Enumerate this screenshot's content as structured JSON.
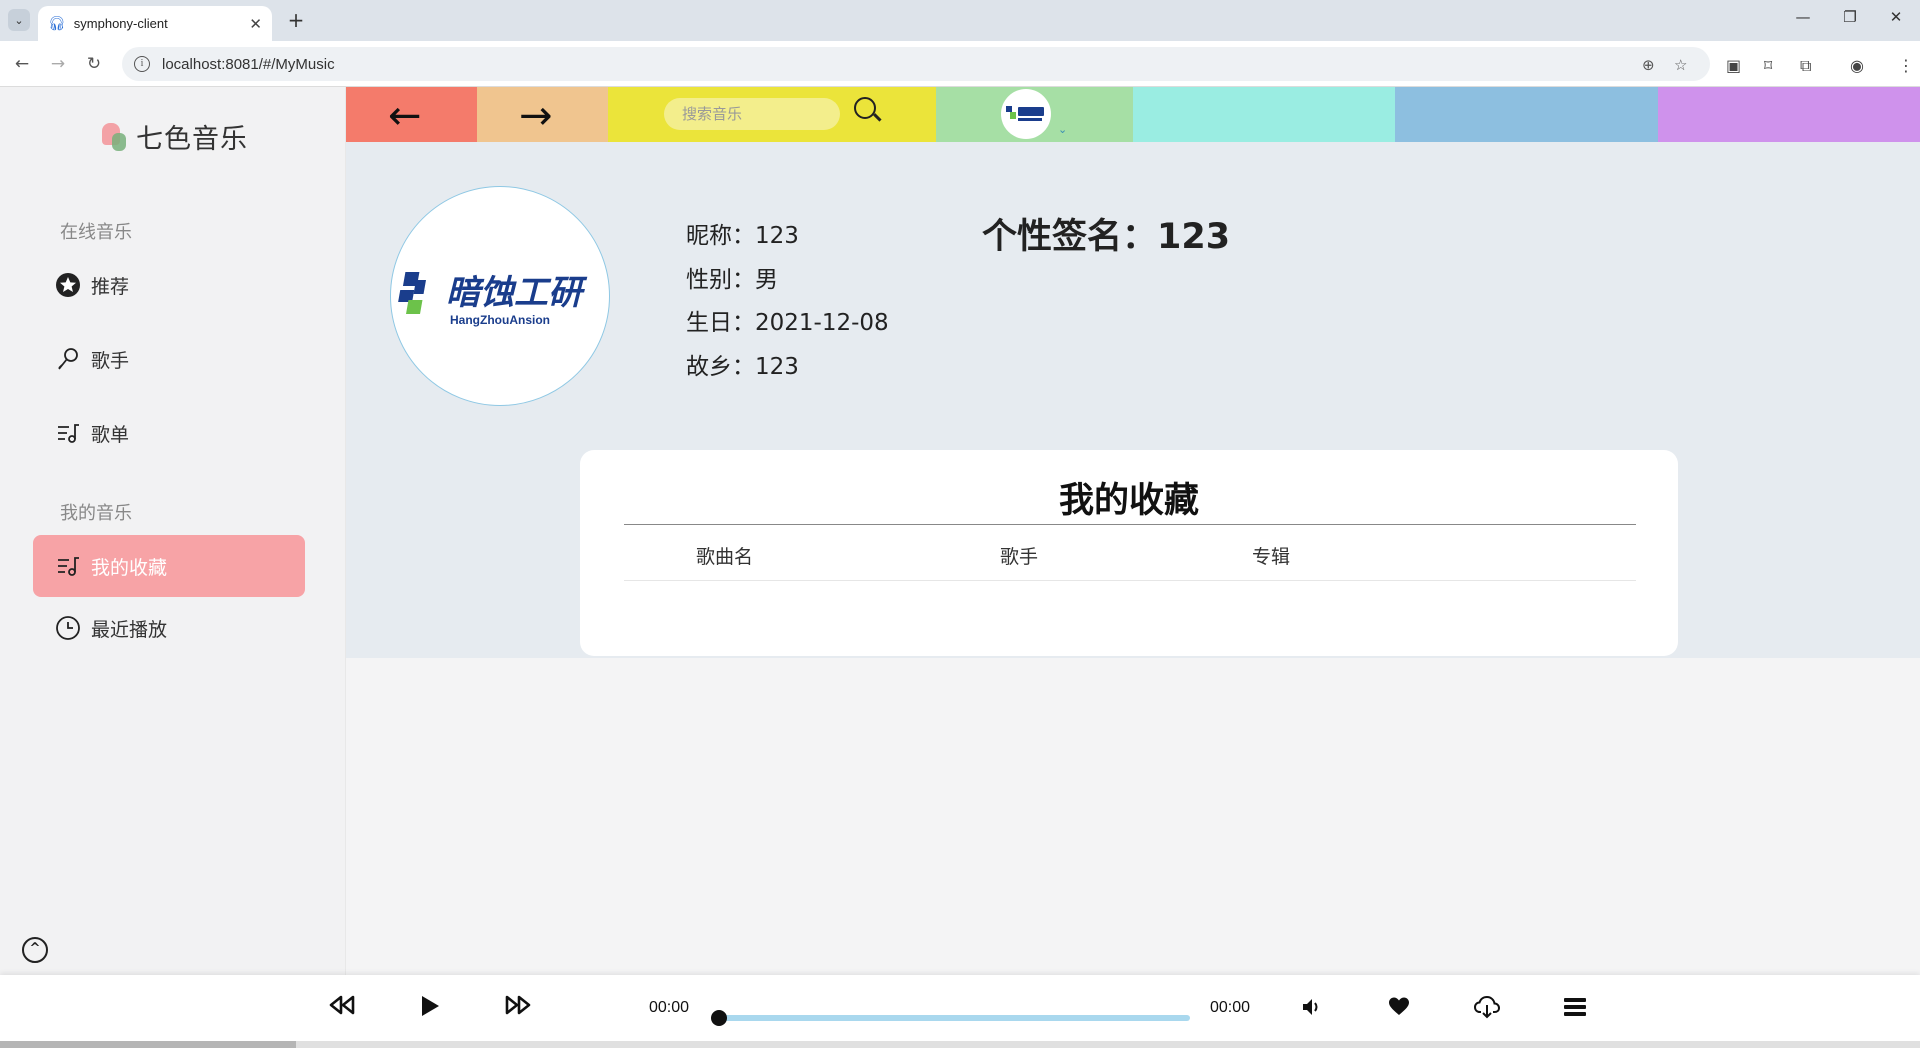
{
  "browser": {
    "tab_title": "symphony-client",
    "url": "localhost:8081/#/MyMusic",
    "tab_close": "✕",
    "new_tab": "+",
    "minimize": "—",
    "restore": "❐",
    "close_window": "✕"
  },
  "sidebar": {
    "logo_text": "七色音乐",
    "section_online": "在线音乐",
    "section_mine": "我的音乐",
    "items": [
      {
        "label": "推荐",
        "icon": "star-icon"
      },
      {
        "label": "歌手",
        "icon": "microphone-icon"
      },
      {
        "label": "歌单",
        "icon": "playlist-icon"
      },
      {
        "label": "我的收藏",
        "icon": "playlist-icon",
        "active": true
      },
      {
        "label": "最近播放",
        "icon": "clock-icon"
      }
    ],
    "active_color": "#f7a3a6"
  },
  "header": {
    "search_placeholder": "搜索音乐",
    "colors": [
      "#f47b6b",
      "#f0c58f",
      "#ebe43a",
      "#a6dfa5",
      "#9aede2",
      "#8dbfe0",
      "#cf92ec"
    ]
  },
  "profile": {
    "nickname_label": "昵称：",
    "nickname": "123",
    "gender_label": "性别：",
    "gender": "男",
    "birthday_label": "生日：",
    "birthday": "2021-12-08",
    "hometown_label": "故乡：",
    "hometown": "123",
    "signature_label": "个性签名：",
    "signature": "123",
    "avatar_logo_text": "暗蚀工研",
    "avatar_logo_sub": "HangZhouAnsion"
  },
  "favorites": {
    "title": "我的收藏",
    "columns": [
      "歌曲名",
      "歌手",
      "专辑"
    ],
    "rows": []
  },
  "player": {
    "current_time": "00:00",
    "total_time": "00:00",
    "progress": 0
  }
}
